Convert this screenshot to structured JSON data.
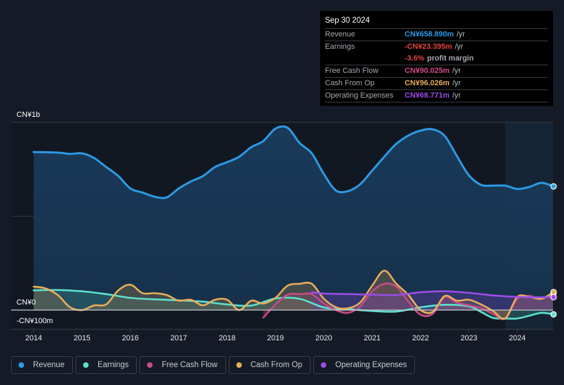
{
  "tooltip": {
    "date": "Sep 30 2024",
    "rows": [
      {
        "label": "Revenue",
        "value": "CN¥658.890m",
        "unit": "/yr",
        "color": "#2d9be6"
      },
      {
        "label": "Earnings",
        "value": "-CN¥23.395m",
        "unit": "/yr",
        "color": "#e8413e"
      },
      {
        "label": "",
        "value": "-3.6%",
        "unit": "profit margin",
        "color": "#e8413e"
      },
      {
        "label": "Free Cash Flow",
        "value": "CN¥90.025m",
        "unit": "/yr",
        "color": "#d64d8c"
      },
      {
        "label": "Cash From Op",
        "value": "CN¥96.026m",
        "unit": "/yr",
        "color": "#e8ad5a"
      },
      {
        "label": "Operating Expenses",
        "value": "CN¥68.771m",
        "unit": "/yr",
        "color": "#9b4de6"
      }
    ]
  },
  "legend": [
    {
      "label": "Revenue",
      "color": "#2d9be6"
    },
    {
      "label": "Earnings",
      "color": "#5ee0cd"
    },
    {
      "label": "Free Cash Flow",
      "color": "#c94b87"
    },
    {
      "label": "Cash From Op",
      "color": "#e8ad5a"
    },
    {
      "label": "Operating Expenses",
      "color": "#9b4de6"
    }
  ],
  "chart_data": {
    "type": "area",
    "title": "",
    "xlabel": "",
    "ylabel": "",
    "y_unit": "CN¥m",
    "ylim": [
      -103,
      1000
    ],
    "xlim": [
      2013.55,
      2024.8
    ],
    "grid": true,
    "legend_position": "bottom-left",
    "y_tick_labels": [
      {
        "value": 1000,
        "label": "CN¥1b"
      },
      {
        "value": 0,
        "label": "CN¥0"
      },
      {
        "value": -100,
        "label": "-CN¥100m"
      }
    ],
    "x_tick_labels": [
      "2014",
      "2015",
      "2016",
      "2017",
      "2018",
      "2019",
      "2020",
      "2021",
      "2022",
      "2023",
      "2024"
    ],
    "x_ticks": [
      2014,
      2015,
      2016,
      2017,
      2018,
      2019,
      2020,
      2021,
      2022,
      2023,
      2024
    ],
    "highlight_from": 2023.75,
    "series": [
      {
        "name": "Revenue",
        "color": "#2d9be6",
        "x": [
          2014,
          2014.5,
          2014.75,
          2015,
          2015.25,
          2015.5,
          2015.75,
          2016,
          2016.25,
          2016.5,
          2016.75,
          2017,
          2017.25,
          2017.5,
          2017.75,
          2018,
          2018.25,
          2018.5,
          2018.75,
          2019,
          2019.25,
          2019.5,
          2019.75,
          2020,
          2020.25,
          2020.5,
          2020.75,
          2021,
          2021.25,
          2021.5,
          2021.75,
          2022,
          2022.25,
          2022.5,
          2022.75,
          2023,
          2023.25,
          2023.5,
          2023.75,
          2024,
          2024.25,
          2024.5,
          2024.75
        ],
        "values": [
          842,
          839,
          832,
          835,
          810,
          762,
          714,
          648,
          626,
          604,
          600,
          648,
          685,
          714,
          762,
          788,
          817,
          868,
          901,
          967,
          971,
          890,
          835,
          725,
          637,
          634,
          670,
          743,
          817,
          886,
          930,
          956,
          963,
          927,
          821,
          718,
          667,
          663,
          663,
          645,
          656,
          678,
          659
        ]
      },
      {
        "name": "Earnings",
        "color": "#5ee0cd",
        "x": [
          2014,
          2014.5,
          2015,
          2015.5,
          2016,
          2016.5,
          2017,
          2017.5,
          2018,
          2018.5,
          2019,
          2019.5,
          2020,
          2020.5,
          2021,
          2021.5,
          2022,
          2022.5,
          2023,
          2023.25,
          2023.5,
          2023.75,
          2024,
          2024.25,
          2024.5,
          2024.75
        ],
        "values": [
          105,
          107,
          100,
          85,
          65,
          57,
          52,
          45,
          30,
          24,
          62,
          60,
          14,
          5,
          -5,
          -8,
          15,
          28,
          20,
          -10,
          -42,
          -45,
          -45,
          -30,
          -15,
          -23
        ]
      },
      {
        "name": "Free Cash Flow",
        "color": "#c94b87",
        "x": [
          2018.75,
          2019,
          2019.25,
          2019.5,
          2019.75,
          2020,
          2020.25,
          2020.5,
          2020.75,
          2021,
          2021.25,
          2021.5,
          2021.75,
          2022,
          2022.25,
          2022.5,
          2022.75,
          2023,
          2023.25,
          2023.5,
          2023.75,
          2024,
          2024.25,
          2024.5,
          2024.75
        ],
        "values": [
          -40,
          30,
          82,
          85,
          85,
          35,
          0,
          -15,
          20,
          100,
          140,
          125,
          45,
          -25,
          -20,
          70,
          40,
          25,
          10,
          -20,
          -45,
          60,
          75,
          60,
          90
        ]
      },
      {
        "name": "Cash From Op",
        "color": "#e8ad5a",
        "x": [
          2014,
          2014.25,
          2014.5,
          2014.75,
          2015,
          2015.25,
          2015.5,
          2015.75,
          2016,
          2016.25,
          2016.5,
          2016.75,
          2017,
          2017.25,
          2017.5,
          2017.75,
          2018,
          2018.25,
          2018.5,
          2018.75,
          2019,
          2019.25,
          2019.5,
          2019.75,
          2020,
          2020.25,
          2020.5,
          2020.75,
          2021,
          2021.25,
          2021.5,
          2021.75,
          2022,
          2022.25,
          2022.5,
          2022.75,
          2023,
          2023.25,
          2023.5,
          2023.75,
          2024,
          2024.25,
          2024.5,
          2024.75
        ],
        "values": [
          125,
          115,
          80,
          15,
          0,
          25,
          30,
          105,
          135,
          90,
          90,
          80,
          50,
          55,
          25,
          55,
          55,
          0,
          50,
          35,
          65,
          130,
          140,
          140,
          60,
          15,
          10,
          40,
          130,
          210,
          140,
          80,
          0,
          -10,
          75,
          50,
          55,
          30,
          -5,
          -45,
          70,
          70,
          60,
          96
        ]
      },
      {
        "name": "Operating Expenses",
        "color": "#9b4de6",
        "x": [
          2019.75,
          2020,
          2020.5,
          2021,
          2021.5,
          2022,
          2022.5,
          2023,
          2023.5,
          2024,
          2024.5,
          2024.75
        ],
        "values": [
          95,
          88,
          85,
          82,
          80,
          95,
          100,
          92,
          78,
          70,
          68,
          69
        ]
      }
    ]
  }
}
